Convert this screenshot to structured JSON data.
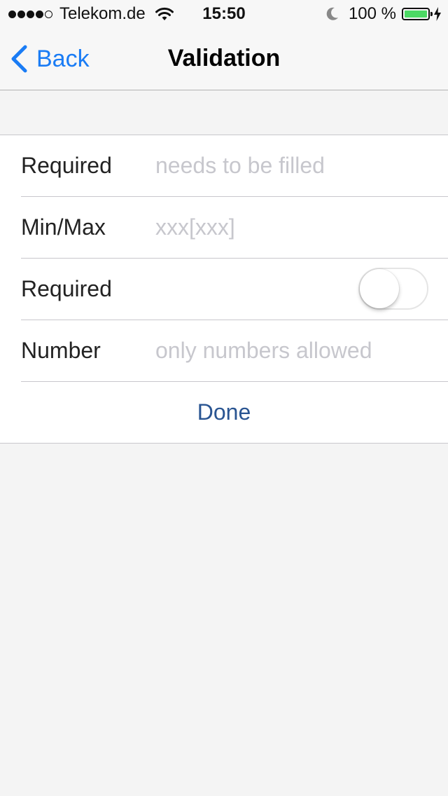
{
  "status_bar": {
    "carrier": "Telekom.de",
    "signal_bars_filled": 4,
    "signal_bars_total": 5,
    "time": "15:50",
    "battery_percent": "100 %",
    "battery_level": 1.0,
    "battery_color": "#4cd964",
    "icons": [
      "wifi-icon",
      "moon-icon",
      "battery-icon",
      "charging-bolt-icon"
    ]
  },
  "nav": {
    "back_label": "Back",
    "back_icon": "chevron-left-icon",
    "title": "Validation",
    "accent_color": "#1a7cf5"
  },
  "form": {
    "rows": [
      {
        "label": "Required",
        "type": "text",
        "value": "",
        "placeholder": "needs to be filled"
      },
      {
        "label": "Min/Max",
        "type": "text",
        "value": "",
        "placeholder": "xxx[xxx]"
      },
      {
        "label": "Required",
        "type": "switch",
        "on": false
      },
      {
        "label": "Number",
        "type": "text",
        "value": "",
        "placeholder": "only numbers allowed"
      }
    ],
    "done_label": "Done",
    "done_color": "#2a5592"
  }
}
